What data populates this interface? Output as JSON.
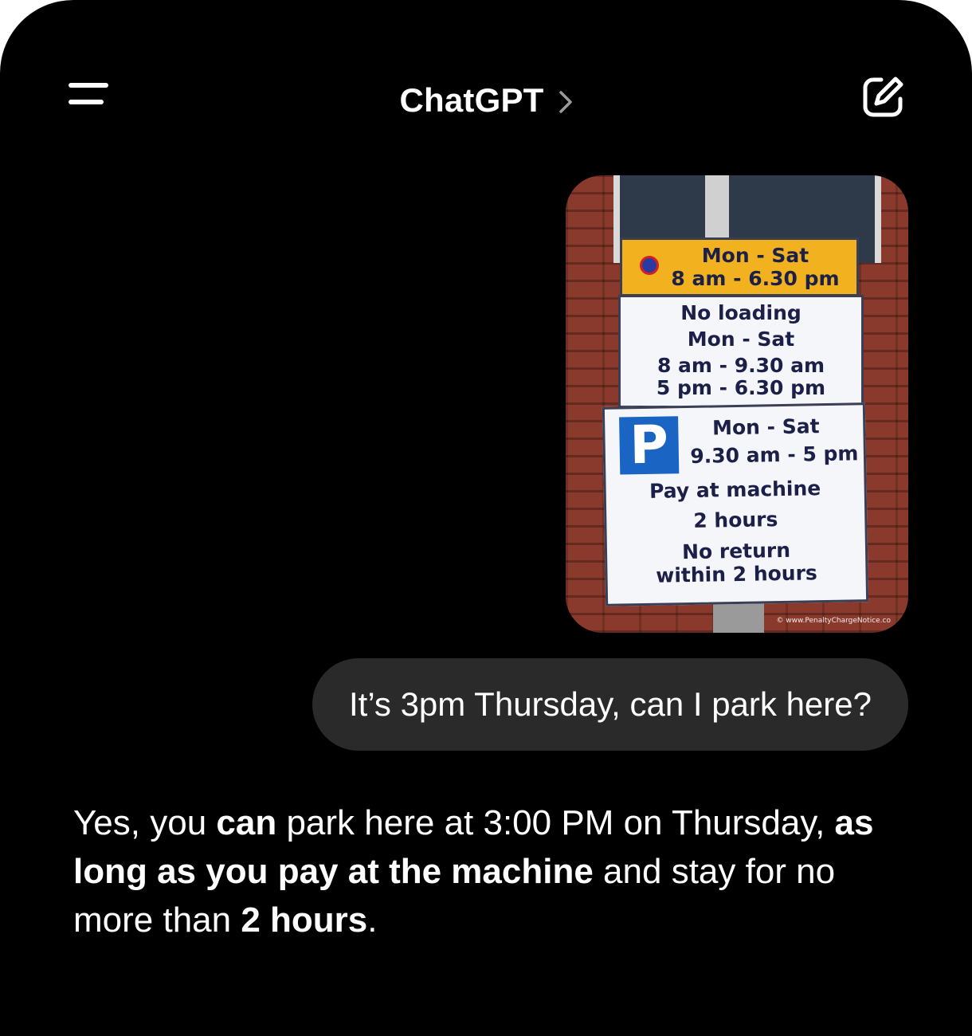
{
  "header": {
    "menu_icon": "menu-icon",
    "title": "ChatGPT",
    "chevron_icon": "chevron-right-icon",
    "compose_icon": "edit-icon"
  },
  "attachment": {
    "sign": {
      "top": {
        "line1": "Mon - Sat",
        "line2": "8 am - 6.30 pm"
      },
      "middle": {
        "line1": "No loading",
        "line2": "Mon - Sat",
        "line3": "8 am - 9.30 am",
        "line4": "5 pm - 6.30 pm"
      },
      "bottom": {
        "p_symbol": "P",
        "line1": "Mon - Sat",
        "line2": "9.30 am - 5 pm",
        "line3": "Pay at machine",
        "line4": "2 hours",
        "line5": "No return",
        "line6": "within 2 hours"
      },
      "watermark": "© www.PenaltyChargeNotice.co"
    }
  },
  "user_message": "It’s 3pm Thursday, can I park here?",
  "assistant_message": {
    "p1": "Yes, you ",
    "b1": "can",
    "p2": " park here at 3:00 PM on Thursday, ",
    "b2": "as long as you pay at the machine",
    "p3": " and stay for no more than ",
    "b3": "2 hours",
    "p4": "."
  },
  "colors": {
    "background": "#000000",
    "bubble": "#2a2a2a",
    "text": "#ffffff"
  }
}
